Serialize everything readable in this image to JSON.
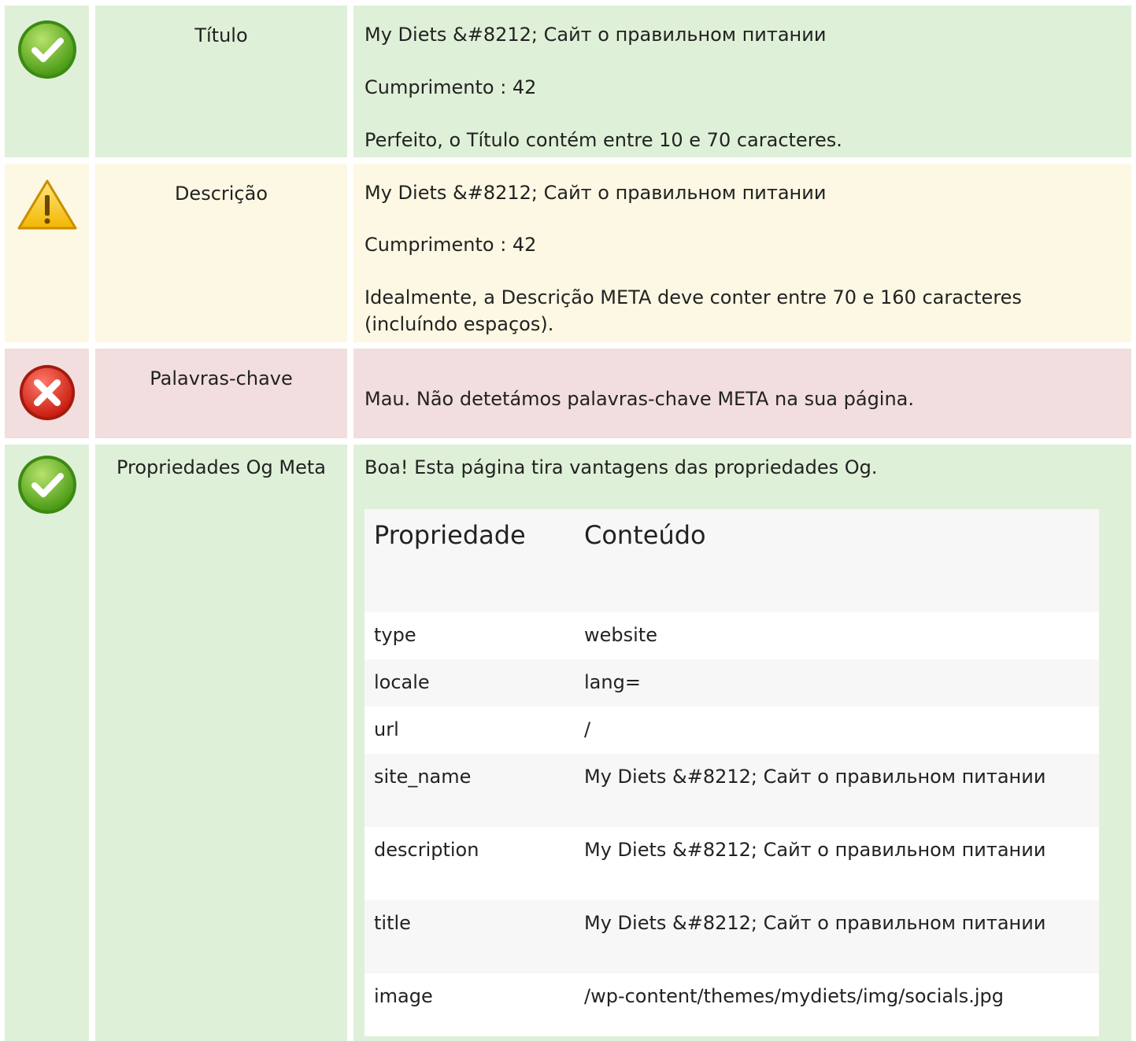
{
  "rows": [
    {
      "status": "ok",
      "icon": "check-circle-icon",
      "label": "Título",
      "lines": [
        "My Diets &#8212; Сайт о правильном питании",
        "Cumprimento : 42",
        "Perfeito, o Título contém entre 10 e 70 caracteres."
      ]
    },
    {
      "status": "warn",
      "icon": "warning-triangle-icon",
      "label": "Descrição",
      "lines": [
        "My Diets &#8212; Сайт о правильном питании",
        "Cumprimento : 42",
        "Idealmente, a Descrição META deve conter entre 70 e 160 caracteres (incluíndo espaços)."
      ]
    },
    {
      "status": "bad",
      "icon": "error-x-circle-icon",
      "label": "Palavras-chave",
      "lines": [
        "Mau. Não detetámos palavras-chave META na sua página."
      ]
    },
    {
      "status": "ok",
      "icon": "check-circle-icon",
      "label": "Propriedades Og Meta",
      "lines": [
        "Boa! Esta página tira vantagens das propriedades Og."
      ],
      "table": {
        "headers": [
          "Propriedade",
          "Conteúdo"
        ],
        "rows": [
          [
            "type",
            "website"
          ],
          [
            "locale",
            "lang="
          ],
          [
            "url",
            "/"
          ],
          [
            "site_name",
            "My Diets &#8212; Сайт о правильном питании"
          ],
          [
            "description",
            "My Diets &#8212; Сайт о правильном питании"
          ],
          [
            "title",
            "My Diets &#8212; Сайт о правильном питании"
          ],
          [
            "image",
            "/wp-content/themes/mydiets/img/socials.jpg"
          ]
        ]
      }
    }
  ],
  "colors": {
    "ok": "#dff0d8",
    "warn": "#fcf8e3",
    "bad": "#f2dede"
  }
}
